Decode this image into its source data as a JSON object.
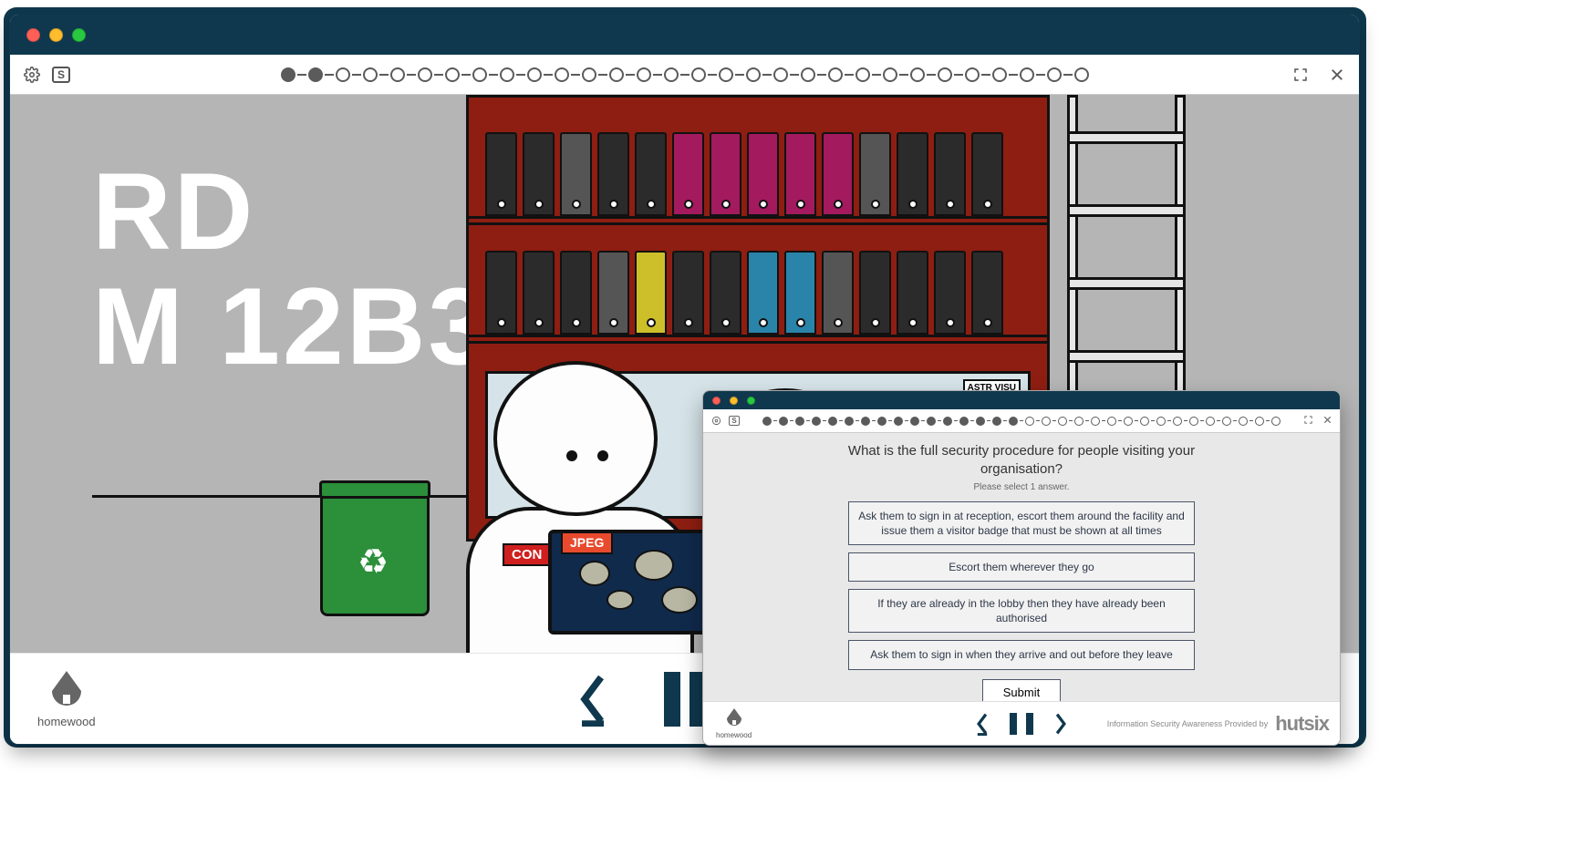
{
  "mainWindow": {
    "posterLine1": "RD",
    "posterLine2": "M 12B3",
    "badgeText": "CON",
    "deviceTag": "JPEG",
    "shelfSign": "ASTR VISU",
    "logoLabel": "homewood",
    "progressTotal": 30,
    "progressDone": 2
  },
  "quizWindow": {
    "question": "What is the full security procedure for people visiting your organisation?",
    "instruction": "Please select 1 answer.",
    "options": [
      "Ask them to sign in at reception, escort them around the facility and issue them a visitor badge that must be shown at all times",
      "Escort them wherever they go",
      "If they are already in the lobby then they have already been authorised",
      "Ask them to sign in when they arrive and out before they leave"
    ],
    "submitLabel": "Submit",
    "logoLabel": "homewood",
    "creditsText": "Information Security Awareness Provided by",
    "vendor": "hutsix",
    "progressTotal": 32,
    "progressDone": 16
  }
}
